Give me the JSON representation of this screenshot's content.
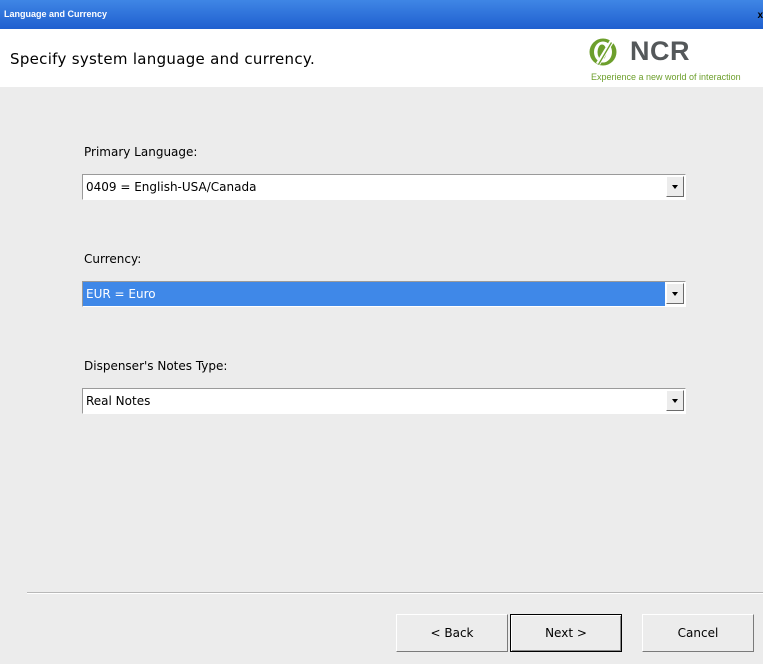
{
  "window": {
    "title": "Language and Currency",
    "close_glyph": "x"
  },
  "header": {
    "instruction": "Specify system language and currency.",
    "logo": {
      "brand": "NCR",
      "tagline": "Experience a new world of interaction",
      "brand_color": "#54585a",
      "accent_color": "#6d9f2c"
    }
  },
  "form": {
    "primary_language": {
      "label": "Primary Language:",
      "value": "0409 = English-USA/Canada"
    },
    "currency": {
      "label": "Currency:",
      "value": "EUR = Euro",
      "selection_color": "#3f88e8"
    },
    "notes_type": {
      "label": "Dispenser's Notes Type:",
      "value": "Real Notes"
    }
  },
  "buttons": {
    "back": "< Back",
    "next": "Next >",
    "cancel": "Cancel"
  },
  "icons": {
    "close": "close-icon",
    "dropdown": "chevron-down-icon",
    "logo": "ncr-logo-mark"
  }
}
